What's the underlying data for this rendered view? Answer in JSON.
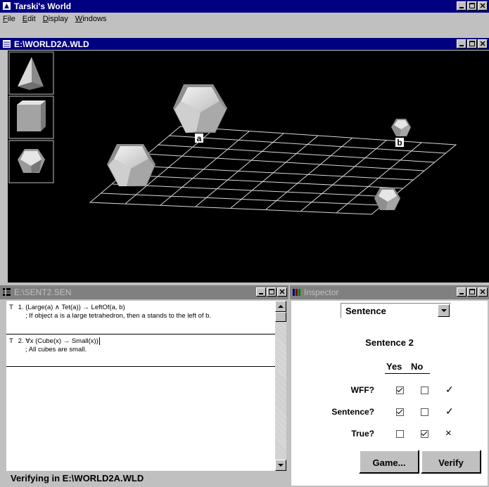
{
  "app": {
    "title": "Tarski's World"
  },
  "menu": [
    "File",
    "Edit",
    "Display",
    "Windows"
  ],
  "menu_underline": [
    "F",
    "E",
    "D",
    "W"
  ],
  "world_window": {
    "title": "E:\\WORLD2A.WLD",
    "labels": {
      "a": "a",
      "b": "b"
    }
  },
  "palette": [
    "tetrahedron-icon",
    "cube-icon",
    "dodecahedron-icon"
  ],
  "sentence_window": {
    "title": "E:\\SENT2.SEN",
    "sentences": [
      {
        "marker": "T",
        "text": "1. (Large(a) ∧ Tet(a)) → LeftOf(a, b)",
        "comment": "; If object a is a large tetrahedron, then a stands to the left of b."
      },
      {
        "marker": "T",
        "text": "2. ∀x (Cube(x) → Small(x))",
        "comment": "; All cubes are small."
      }
    ],
    "status": "Verifying in E:\\WORLD2A.WLD"
  },
  "inspector": {
    "title": "Inspector",
    "mode": "Sentence",
    "heading": "Sentence 2",
    "col_yes": "Yes",
    "col_no": "No",
    "rows": [
      {
        "label": "WFF?",
        "yes": true,
        "no": false,
        "result": "✓"
      },
      {
        "label": "Sentence?",
        "yes": true,
        "no": false,
        "result": "✓"
      },
      {
        "label": "True?",
        "yes": false,
        "no": true,
        "result": "×"
      }
    ],
    "game_button": "Game...",
    "verify_button": "Verify"
  },
  "colors": {
    "titlebar_active": "#000080",
    "titlebar_inactive": "#808080",
    "chrome": "#c0c0c0",
    "world_bg": "#000000"
  }
}
